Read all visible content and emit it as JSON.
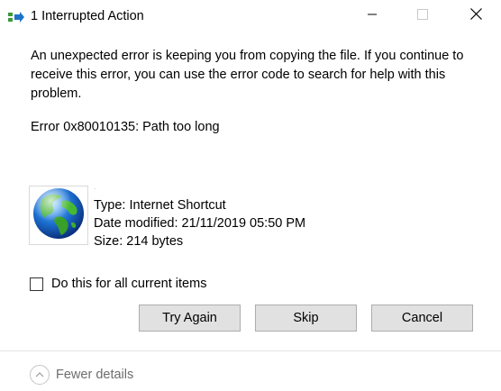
{
  "window": {
    "title": "1 Interrupted Action"
  },
  "message": {
    "body": "An unexpected error is keeping you from copying the file. If you continue to receive this error, you can use the error code to search for help with this problem.",
    "error": "Error 0x80010135: Path too long"
  },
  "file": {
    "name": "·",
    "type": "Type: Internet Shortcut",
    "date_modified": "Date modified: 21/11/2019 05:50 PM",
    "size": "Size: 214 bytes",
    "icon": "globe-icon"
  },
  "checkbox": {
    "label": "Do this for all current items",
    "checked": false
  },
  "buttons": {
    "retry": "Try Again",
    "skip": "Skip",
    "cancel": "Cancel"
  },
  "footer": {
    "details_label": "Fewer details"
  },
  "colors": {
    "button_bg": "#e1e1e1",
    "button_border": "#adadad",
    "muted_text": "#6d6d6d"
  }
}
